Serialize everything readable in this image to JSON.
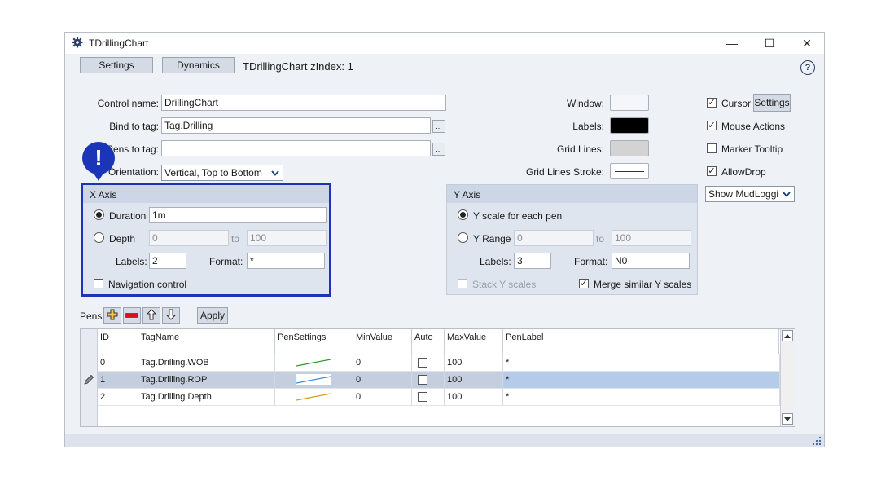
{
  "window": {
    "title": "TDrillingChart",
    "controls": {
      "minimize": "—",
      "maximize": "☐",
      "close": "✕"
    },
    "help_icon": "?"
  },
  "tabs": {
    "settings": "Settings",
    "dynamics": "Dynamics",
    "heading": "TDrillingChart zIndex: 1"
  },
  "form": {
    "control_name_label": "Control name:",
    "control_name_value": "DrillingChart",
    "bind_label": "Bind to tag:",
    "bind_value": "Tag.Drilling",
    "pens_label": "Pens to tag:",
    "pens_value": "",
    "orientation_label": "Orientation:",
    "orientation_value": "Vertical, Top to Bottom",
    "browse": "..."
  },
  "colors_panel": {
    "window_label": "Window:",
    "labels_label": "Labels:",
    "gridlines_label": "Grid Lines:",
    "gridstroke_label": "Grid Lines Stroke:",
    "window_color": "#f4f6fa",
    "labels_color": "#000000",
    "gridlines_color": "#d3d3d3"
  },
  "options": {
    "cursor": "Cursor",
    "cursor_settings": "Settings",
    "mouse_actions": "Mouse Actions",
    "marker_tooltip": "Marker Tooltip",
    "allow_drop": "AllowDrop",
    "mudlog_select": "Show MudLoggi",
    "check": "✓"
  },
  "x_axis": {
    "title": "X Axis",
    "duration_label": "Duration",
    "duration_value": "1m",
    "depth_label": "Depth",
    "depth_from": "0",
    "to": "to",
    "depth_to": "100",
    "labels_label": "Labels:",
    "labels_value": "2",
    "format_label": "Format:",
    "format_value": "*",
    "nav_label": "Navigation control"
  },
  "y_axis": {
    "title": "Y Axis",
    "scale_each_label": "Y scale for each pen",
    "range_label": "Y Range",
    "range_from": "0",
    "to": "to",
    "range_to": "100",
    "labels_label": "Labels:",
    "labels_value": "3",
    "format_label": "Format:",
    "format_value": "N0",
    "stack_label": "Stack Y scales",
    "merge_label": "Merge similar Y scales"
  },
  "pens": {
    "label": "Pens",
    "apply": "Apply",
    "columns": [
      "ID",
      "TagName",
      "PenSettings",
      "MinValue",
      "Auto",
      "MaxValue",
      "PenLabel"
    ],
    "rows": [
      {
        "id": "0",
        "tag": "Tag.Drilling.WOB",
        "color": "#2e9b2e",
        "min": "0",
        "max": "100",
        "label": "*"
      },
      {
        "id": "1",
        "tag": "Tag.Drilling.ROP",
        "color": "#3b8fd9",
        "min": "0",
        "max": "100",
        "label": "*"
      },
      {
        "id": "2",
        "tag": "Tag.Drilling.Depth",
        "color": "#d99a1e",
        "min": "0",
        "max": "100",
        "label": "*"
      }
    ]
  },
  "alert_badge": "!",
  "accent": "#1a35b8"
}
